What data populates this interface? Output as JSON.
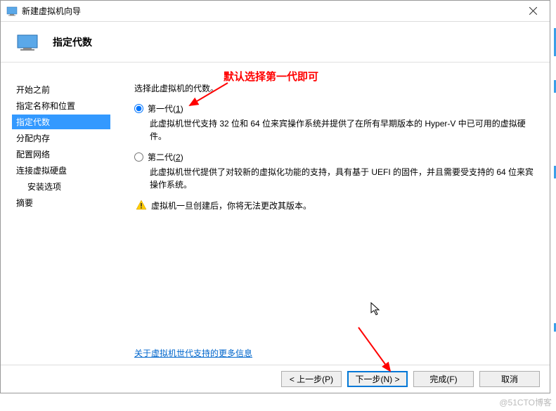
{
  "window": {
    "title": "新建虚拟机向导"
  },
  "header": {
    "title": "指定代数"
  },
  "sidebar": {
    "items": [
      {
        "label": "开始之前"
      },
      {
        "label": "指定名称和位置"
      },
      {
        "label": "指定代数"
      },
      {
        "label": "分配内存"
      },
      {
        "label": "配置网络"
      },
      {
        "label": "连接虚拟硬盘"
      },
      {
        "label": "安装选项"
      },
      {
        "label": "摘要"
      }
    ],
    "activeIndex": 2,
    "subIndex": 6
  },
  "content": {
    "instruction": "选择此虚拟机的代数。",
    "gen1_label": "第一代(1)",
    "gen1_desc": "此虚拟机世代支持 32 位和 64 位来宾操作系统并提供了在所有早期版本的 Hyper-V 中已可用的虚拟硬件。",
    "gen2_label": "第二代(2)",
    "gen2_desc": "此虚拟机世代提供了对较新的虚拟化功能的支持，具有基于 UEFI 的固件，并且需要受支持的 64 位来宾操作系统。",
    "warning": "虚拟机一旦创建后，你将无法更改其版本。",
    "link": "关于虚拟机世代支持的更多信息"
  },
  "footer": {
    "prev": "< 上一步(P)",
    "next": "下一步(N) >",
    "finish": "完成(F)",
    "cancel": "取消"
  },
  "annotation": {
    "text1": "默认选择第一代即可"
  },
  "watermark": "@51CTO博客"
}
